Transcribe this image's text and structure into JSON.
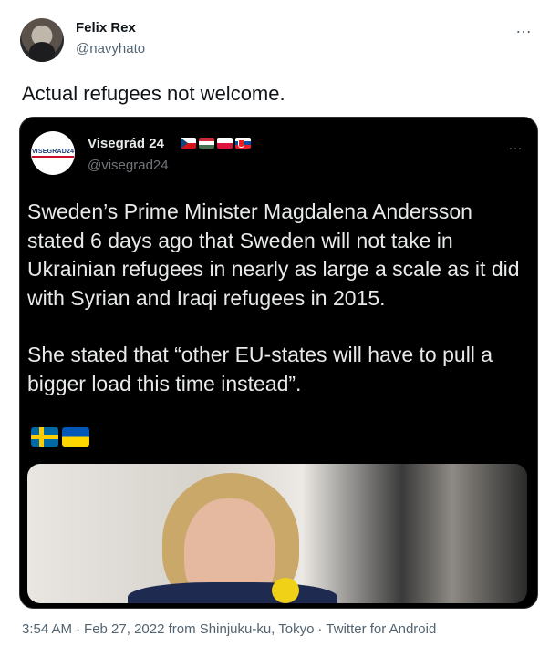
{
  "tweet": {
    "author": {
      "name": "Felix Rex",
      "handle": "@navyhato"
    },
    "text": "Actual refugees not welcome.",
    "more_icon": "…",
    "quoted": {
      "name": "Visegrád 24",
      "handle": "@visegrad24",
      "avatar_text": "VISEGRAD24",
      "flags": [
        "czech-flag",
        "hungary-flag",
        "poland-flag",
        "slovakia-flag"
      ],
      "paragraphs": [
        "Sweden’s Prime Minister Magdalena Andersson stated 6 days ago that Sweden will not take in Ukrainian refugees in nearly as large a scale as it did with Syrian and Iraqi refugees in 2015.",
        "She stated that “other EU-states will have to pull a bigger load this time instead”."
      ],
      "emoji_flags": [
        "sweden-flag",
        "ukraine-flag"
      ]
    },
    "meta": {
      "time": "3:54 AM",
      "date": "Feb 27, 2022",
      "location": "from Shinjuku-ku, Tokyo",
      "source": "Twitter for Android",
      "separator": "·"
    }
  },
  "colors": {
    "text_primary": "#0f1419",
    "text_secondary": "#536471",
    "card_background": "#000000",
    "card_text": "#e7e9ea"
  }
}
